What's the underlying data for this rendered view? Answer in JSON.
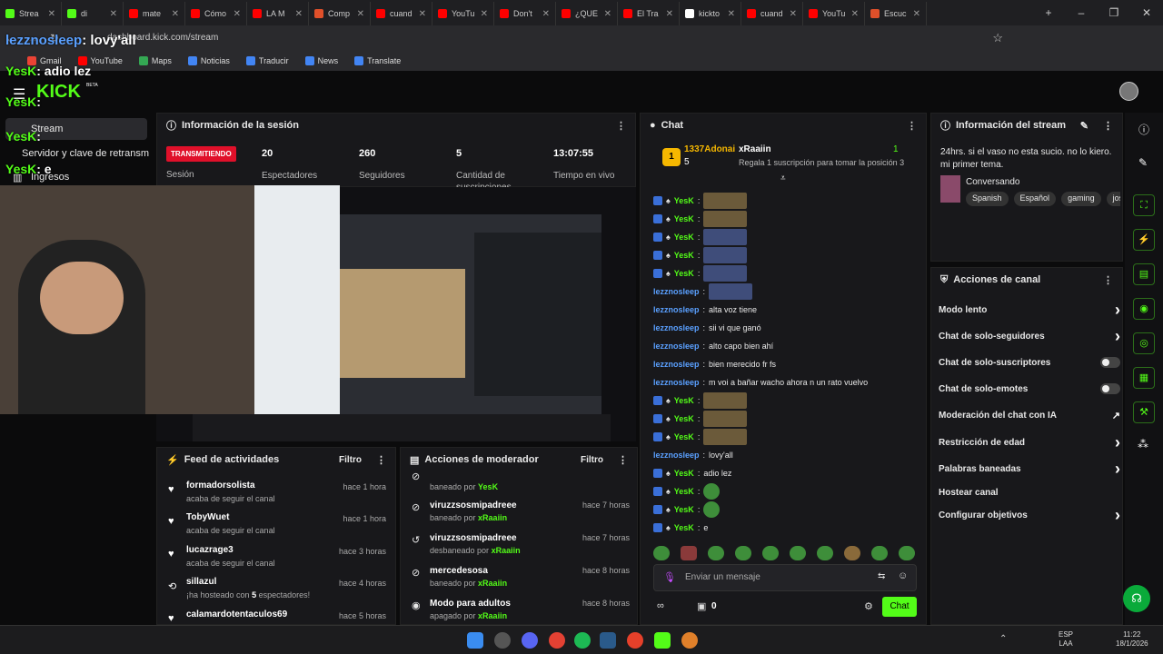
{
  "browser": {
    "tabs": [
      {
        "label": "Strea",
        "color": "#53fc18"
      },
      {
        "label": "di",
        "color": "#53fc18"
      },
      {
        "label": "mate",
        "color": "#ff0000"
      },
      {
        "label": "Cómo",
        "color": "#ff0000"
      },
      {
        "label": "LA M",
        "color": "#ff0000"
      },
      {
        "label": "Comp",
        "color": "#e0502a"
      },
      {
        "label": "cuand",
        "color": "#ff0000"
      },
      {
        "label": "YouTu",
        "color": "#ff0000"
      },
      {
        "label": "Don't",
        "color": "#ff0000"
      },
      {
        "label": "¿QUE",
        "color": "#ff0000"
      },
      {
        "label": "El Tra",
        "color": "#ff0000"
      },
      {
        "label": "kickto",
        "color": "#ffffff"
      },
      {
        "label": "cuand",
        "color": "#ff0000"
      },
      {
        "label": "YouTu",
        "color": "#ff0000"
      },
      {
        "label": "Escuc",
        "color": "#e0502a"
      }
    ],
    "url": "dashboard.kick.com/stream",
    "bookmarks": [
      "Gmail",
      "YouTube",
      "Maps",
      "Noticias",
      "Traducir",
      "News",
      "Translate"
    ]
  },
  "kick": {
    "logo": "KICK",
    "logo_badge": "BETA",
    "nav": {
      "stream": "Stream",
      "stream_key": "Servidor y clave de retransm",
      "income": "Ingresos"
    }
  },
  "session": {
    "title": "Información de la sesión",
    "live_badge": "TRANSMITIENDO",
    "session_label": "Sesión",
    "stats": [
      {
        "value": "20",
        "label": "Espectadores"
      },
      {
        "value": "260",
        "label": "Seguidores"
      },
      {
        "value": "5",
        "label": "Cantidad de suscripciones"
      },
      {
        "value": "13:07:55",
        "label": "Tiempo en vivo"
      }
    ]
  },
  "feed": {
    "title": "Feed de actividades",
    "filter": "Filtro",
    "items": [
      {
        "name": "formadorsolista",
        "sub": "acaba de seguir el canal",
        "time": "hace 1 hora",
        "icon": "heart-icon"
      },
      {
        "name": "TobyWuet",
        "sub": "acaba de seguir el canal",
        "time": "hace 1 hora",
        "icon": "heart-icon"
      },
      {
        "name": "lucazrage3",
        "sub": "acaba de seguir el canal",
        "time": "hace 3 horas",
        "icon": "heart-icon"
      },
      {
        "name": "sillazul",
        "sub_prefix": "¡ha hosteado con ",
        "sub_count": "5",
        "sub_suffix": " espectadores!",
        "time": "hace 4 horas",
        "icon": "host-icon"
      },
      {
        "name": "calamardotentaculos69",
        "sub": "",
        "time": "hace 5 horas",
        "icon": "heart-icon"
      }
    ]
  },
  "mod": {
    "title": "Acciones de moderador",
    "filter": "Filtro",
    "items": [
      {
        "name": "",
        "sub_prefix": "baneado por ",
        "by": "YesK",
        "time": "",
        "icon": "ban-icon"
      },
      {
        "name": "viruzzsosmipadreee",
        "sub_prefix": "baneado por ",
        "by": "xRaaiin",
        "time": "hace 7 horas",
        "icon": "ban-icon"
      },
      {
        "name": "viruzzsosmipadreee",
        "sub_prefix": "desbaneado por ",
        "by": "xRaaiin",
        "time": "hace 7 horas",
        "icon": "unban-icon"
      },
      {
        "name": "mercedesosa",
        "sub_prefix": "baneado por ",
        "by": "xRaaiin",
        "time": "hace 8 horas",
        "icon": "ban-icon"
      },
      {
        "name": "Modo para adultos",
        "sub_prefix": "apagado por ",
        "by": "xRaaiin",
        "time": "hace 8 horas",
        "icon": "eye-icon"
      }
    ]
  },
  "chat": {
    "title": "Chat",
    "top_gifter": {
      "rank": "1",
      "name": "1337Adonai",
      "count": "5"
    },
    "second": {
      "name": "xRaaiin",
      "count": "1",
      "cta": "Regala 1 suscripción para tomar la posición 3"
    },
    "messages": [
      {
        "user": "YesK",
        "type": "emote",
        "text": ""
      },
      {
        "user": "YesK",
        "type": "emote",
        "text": ""
      },
      {
        "user": "YesK",
        "type": "emote-b",
        "text": ""
      },
      {
        "user": "YesK",
        "type": "emote-b",
        "text": ""
      },
      {
        "user": "YesK",
        "type": "emote-b",
        "text": ""
      },
      {
        "user": "lezznosleep",
        "type": "emote-b",
        "text": ""
      },
      {
        "user": "lezznosleep",
        "type": "text",
        "text": "alta voz tiene"
      },
      {
        "user": "lezznosleep",
        "type": "text",
        "text": "sii vi que ganó"
      },
      {
        "user": "lezznosleep",
        "type": "text",
        "text": "alto capo bien ahí"
      },
      {
        "user": "lezznosleep",
        "type": "text",
        "text": "bien merecido fr fs"
      },
      {
        "user": "lezznosleep",
        "type": "text",
        "text": "m voi a bañar wacho ahora n un rato vuelvo"
      },
      {
        "user": "YesK",
        "type": "emote",
        "text": ""
      },
      {
        "user": "YesK",
        "type": "emote",
        "text": ""
      },
      {
        "user": "YesK",
        "type": "emote",
        "text": ""
      },
      {
        "user": "lezznosleep",
        "type": "text",
        "text": "lovy'all"
      },
      {
        "user": "YesK",
        "type": "text",
        "text": "adio lez"
      },
      {
        "user": "YesK",
        "type": "emote-g",
        "text": ""
      },
      {
        "user": "YesK",
        "type": "emote-g",
        "text": ""
      },
      {
        "user": "YesK",
        "type": "text",
        "text": "e"
      }
    ],
    "input_placeholder": "Enviar un mensaje",
    "send_label": "Chat",
    "points": "0"
  },
  "stream_info": {
    "title": "Información del stream",
    "description": "24hrs. si el vaso no esta sucio. no lo kiero. mi primer tema.",
    "category": "Conversando",
    "tags": [
      "Spanish",
      "Español",
      "gaming",
      "jose"
    ]
  },
  "channel_actions": {
    "title": "Acciones de canal",
    "items": [
      {
        "label": "Modo lento",
        "control": "chevron"
      },
      {
        "label": "Chat de solo-seguidores",
        "control": "chevron"
      },
      {
        "label": "Chat de solo-suscriptores",
        "control": "toggle"
      },
      {
        "label": "Chat de solo-emotes",
        "control": "toggle"
      },
      {
        "label": "Moderación del chat con IA",
        "control": "external"
      },
      {
        "label": "Restricción de edad",
        "control": "chevron"
      },
      {
        "label": "Palabras baneadas",
        "control": "chevron"
      },
      {
        "label": "Hostear canal",
        "control": "none"
      },
      {
        "label": "Configurar objetivos",
        "control": "chevron"
      }
    ]
  },
  "overlay": {
    "lines": [
      {
        "user": "lezznosleep",
        "text": ": lovy'all"
      },
      {
        "user": "YesK",
        "text": ": adio lez"
      },
      {
        "user": "YesK",
        "text": ":"
      },
      {
        "user": "YesK",
        "text": ":"
      },
      {
        "user": "YesK",
        "text": ": e"
      }
    ]
  },
  "taskbar": {
    "lang": "ESP",
    "lang2": "LAA",
    "time": "11:22",
    "date": "18/1/2026"
  },
  "colors": {
    "accent": "#53fc18",
    "live": "#e0102a",
    "username": "#5aa0ff"
  }
}
